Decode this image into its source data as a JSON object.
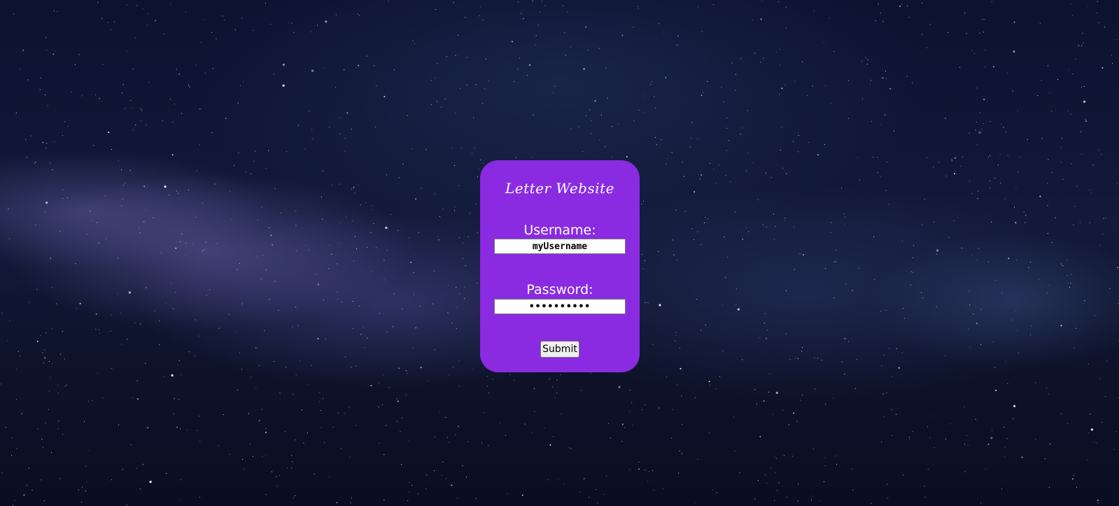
{
  "page": {
    "background_theme": "starry-night-sky",
    "card_color": "#8a2be2"
  },
  "login": {
    "title": "Letter Website",
    "username_label": "Username:",
    "username_value": "myUsername",
    "password_label": "Password:",
    "password_value": "••••••••••",
    "submit_label": "Submit"
  }
}
